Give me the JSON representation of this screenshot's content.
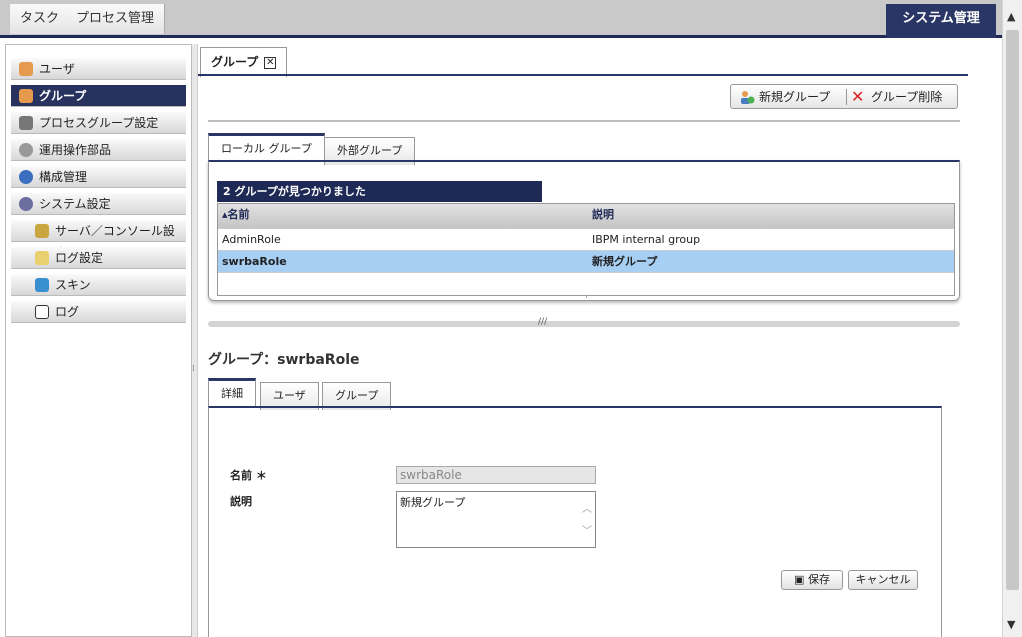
{
  "topnav": {
    "tabs": [
      "タスク",
      "プロセス管理"
    ],
    "system": "システム管理"
  },
  "sidebar": {
    "items": [
      {
        "label": "ユーザ",
        "icon": "user-icon"
      },
      {
        "label": "グループ",
        "icon": "group-icon"
      },
      {
        "label": "プロセスグループ設定",
        "icon": "tools-icon"
      },
      {
        "label": "運用操作部品",
        "icon": "gear-icon"
      },
      {
        "label": "構成管理",
        "icon": "config-icon"
      },
      {
        "label": "システム設定",
        "icon": "settings-icon"
      },
      {
        "label": "サーバ／コンソール設定",
        "icon": "server-icon"
      },
      {
        "label": "ログ設定",
        "icon": "log-settings-icon"
      },
      {
        "label": "スキン",
        "icon": "skin-icon"
      },
      {
        "label": "ログ",
        "icon": "log-icon"
      }
    ],
    "active_index": 1
  },
  "page_tab": {
    "label": "グループ"
  },
  "toolbar": {
    "new_group": "新規グループ",
    "delete_group": "グループ削除"
  },
  "group_tabs": {
    "local": "ローカル グループ",
    "external": "外部グループ"
  },
  "list": {
    "found": "2 グループが見つかりました",
    "headers": [
      "名前",
      "説明"
    ],
    "rows": [
      {
        "name": "AdminRole",
        "desc": "IBPM internal group"
      },
      {
        "name": "swrbaRole",
        "desc": "新規グループ"
      }
    ],
    "selected_index": 1
  },
  "detail": {
    "title": "グループ：swrbaRole",
    "tabs": [
      "詳細",
      "ユーザ",
      "グループ"
    ],
    "name_label": "名前 ＊",
    "desc_label": "説明",
    "name_value": "swrbaRole",
    "desc_value": "新規グループ",
    "save": "保存",
    "cancel": "キャンセル"
  },
  "colors": {
    "navy": "#1e2a55",
    "selected_row": "#a6cff3"
  }
}
